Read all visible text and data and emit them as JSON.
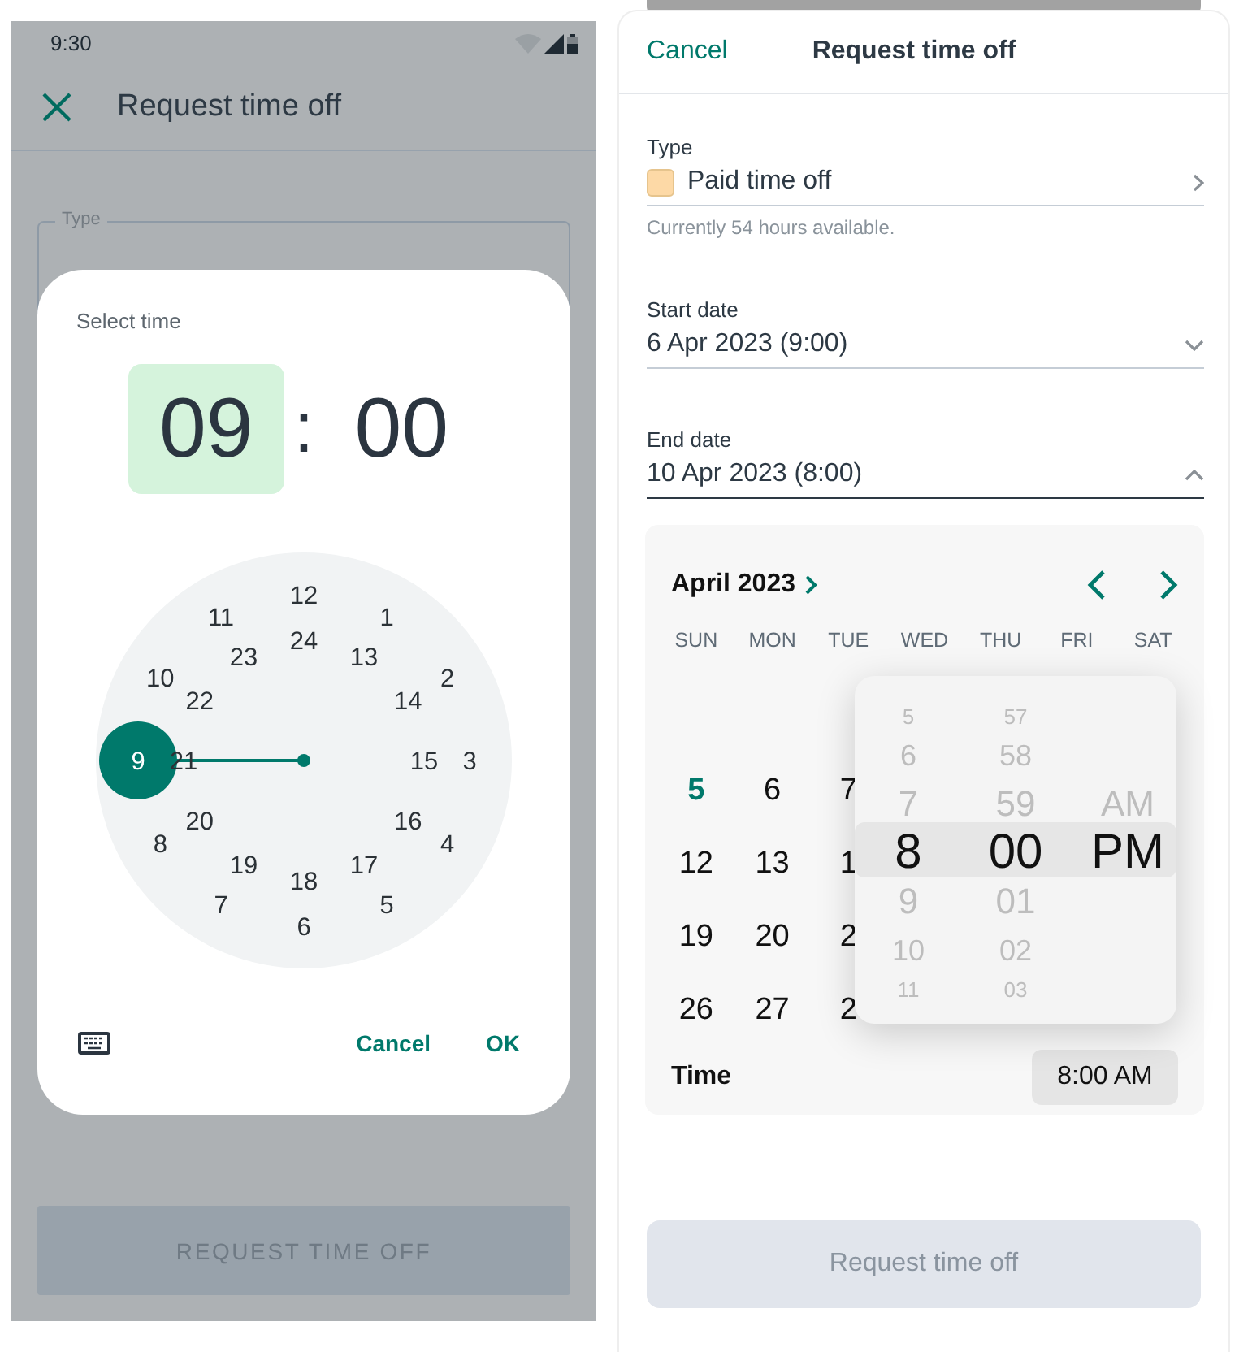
{
  "android": {
    "status_bar": {
      "time": "9:30"
    },
    "app_bar": {
      "title": "Request time off"
    },
    "type_field": {
      "label": "Type"
    },
    "time_dialog": {
      "title": "Select time",
      "hour": {
        "value": "09",
        "selected": true
      },
      "separator": ":",
      "minute": {
        "value": "00",
        "selected": false
      },
      "outer_ring": [
        {
          "label": "12",
          "selected": false
        },
        {
          "label": "1",
          "selected": false
        },
        {
          "label": "2",
          "selected": false
        },
        {
          "label": "3",
          "selected": false
        },
        {
          "label": "4",
          "selected": false
        },
        {
          "label": "5",
          "selected": false
        },
        {
          "label": "6",
          "selected": false
        },
        {
          "label": "7",
          "selected": false
        },
        {
          "label": "8",
          "selected": false
        },
        {
          "label": "9",
          "selected": true
        },
        {
          "label": "10",
          "selected": false
        },
        {
          "label": "11",
          "selected": false
        }
      ],
      "inner_ring": [
        {
          "label": "24",
          "selected": false
        },
        {
          "label": "13",
          "selected": false
        },
        {
          "label": "14",
          "selected": false
        },
        {
          "label": "15",
          "selected": false
        },
        {
          "label": "16",
          "selected": false
        },
        {
          "label": "17",
          "selected": false
        },
        {
          "label": "18",
          "selected": false
        },
        {
          "label": "19",
          "selected": false
        },
        {
          "label": "20",
          "selected": false
        },
        {
          "label": "21",
          "selected": false
        },
        {
          "label": "22",
          "selected": false
        },
        {
          "label": "23",
          "selected": false
        }
      ],
      "actions": [
        "Cancel",
        "OK"
      ]
    },
    "submit": {
      "label": "REQUEST TIME OFF",
      "disabled": true
    }
  },
  "ios": {
    "header": {
      "cancel": "Cancel",
      "title": "Request time off"
    },
    "type": {
      "label": "Type",
      "value": "Paid time off",
      "color": "#fdd9a6",
      "helper": "Currently 54 hours available."
    },
    "start_date": {
      "label": "Start date",
      "value": "6 Apr 2023 (9:00)",
      "expanded": false
    },
    "end_date": {
      "label": "End date",
      "value": "10 Apr 2023 (8:00)",
      "expanded": true
    },
    "calendar": {
      "month": "April 2023",
      "weekdays": [
        "SUN",
        "MON",
        "TUE",
        "WED",
        "THU",
        "FRI",
        "SAT"
      ],
      "weeks": [
        [
          {
            "day": "5",
            "today": true
          },
          {
            "day": "6",
            "today": false
          },
          {
            "day": "7",
            "today": false
          }
        ],
        [
          {
            "day": "12",
            "today": false
          },
          {
            "day": "13",
            "today": false
          },
          {
            "day": "1",
            "today": false
          }
        ],
        [
          {
            "day": "19",
            "today": false
          },
          {
            "day": "20",
            "today": false
          },
          {
            "day": "2",
            "today": false
          }
        ],
        [
          {
            "day": "26",
            "today": false
          },
          {
            "day": "27",
            "today": false
          },
          {
            "day": "2",
            "today": false
          }
        ]
      ],
      "time_label": "Time",
      "time_value": "8:00 AM"
    },
    "time_wheel": {
      "columns": [
        [
          {
            "label": "5",
            "selected": false
          },
          {
            "label": "6",
            "selected": false
          },
          {
            "label": "7",
            "selected": false
          },
          {
            "label": "8",
            "selected": true
          },
          {
            "label": "9",
            "selected": false
          },
          {
            "label": "10",
            "selected": false
          },
          {
            "label": "11",
            "selected": false
          }
        ],
        [
          {
            "label": "57",
            "selected": false
          },
          {
            "label": "58",
            "selected": false
          },
          {
            "label": "59",
            "selected": false
          },
          {
            "label": "00",
            "selected": true
          },
          {
            "label": "01",
            "selected": false
          },
          {
            "label": "02",
            "selected": false
          },
          {
            "label": "03",
            "selected": false
          }
        ],
        [
          {
            "label": "AM",
            "selected": false
          },
          {
            "label": "PM",
            "selected": true
          }
        ]
      ]
    },
    "submit": {
      "label": "Request time off",
      "disabled": true
    }
  }
}
